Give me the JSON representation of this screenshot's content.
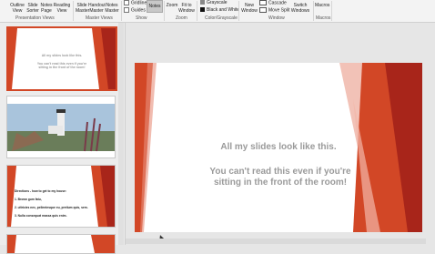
{
  "ribbon": {
    "presentation_views": {
      "outline": "Outline View",
      "slide_sorter": "Slide Sorter",
      "notes_page": "Notes Page",
      "reading_view": "Reading View",
      "group": "Presentation Views"
    },
    "master_views": {
      "slide_master": "Slide Master",
      "handout_master": "Handout Master",
      "notes_master": "Notes Master",
      "group": "Master Views"
    },
    "show": {
      "gridlines": "Gridlines",
      "guides": "Guides",
      "notes": "Notes",
      "group": "Show"
    },
    "zoom": {
      "zoom": "Zoom",
      "fit": "Fit to Window",
      "group": "Zoom"
    },
    "color": {
      "grayscale": "Grayscale",
      "bw": "Black and White",
      "group": "Color/Grayscale"
    },
    "window": {
      "new_window": "New Window",
      "cascade": "Cascade",
      "move_split": "Move Split",
      "switch": "Switch Windows",
      "group": "Window"
    },
    "macros": {
      "macros": "Macros",
      "group": "Macros"
    }
  },
  "thumbs": {
    "t1_title": "All my slides look like this.",
    "t1_body": "You can't read this even if you're sitting in the front of the room!",
    "t3_title": "Directions - how to get to my house:",
    "t3_items": [
      "1. Brown gum fatu,",
      "2. ultricies nec, pellentesque eu, pretium quis, sem.",
      "3. Nulla consequat massa quis enim."
    ]
  },
  "slide": {
    "title": "All my slides look like this.",
    "body": "You can't read this even if you're sitting in the front of the room!"
  },
  "colors": {
    "accent": "#d24726",
    "dark_red": "#a8251a",
    "light_red": "#e8907c"
  }
}
